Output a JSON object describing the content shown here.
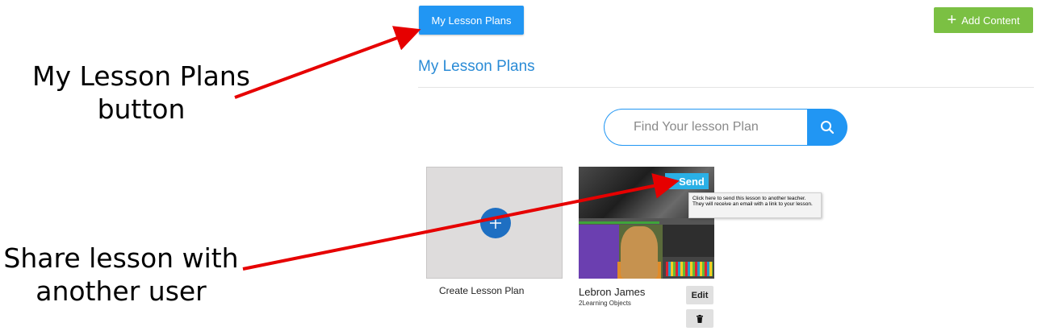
{
  "annotations": {
    "first_line1": "My Lesson Plans",
    "first_line2": "button",
    "second_line1": "Share lesson with",
    "second_line2": "another user",
    "arrow_color": "#e60000"
  },
  "header": {
    "my_lesson_plans_button": "My Lesson Plans",
    "add_content_button": "Add Content",
    "primary_color": "#2196f3",
    "add_color": "#7bc043"
  },
  "page": {
    "title": "My Lesson Plans"
  },
  "search": {
    "placeholder": "Find Your lesson Plan",
    "icon": "search-icon"
  },
  "create_card": {
    "label": "Create Lesson Plan",
    "icon": "plus-icon"
  },
  "lesson_card": {
    "send_label": "Send",
    "tooltip": "Click here to send this lesson to another teacher.  They will receive an email with a link to your lesson.",
    "title": "Lebron James",
    "meta": "2Learning Objects",
    "edit_label": "Edit",
    "delete_icon": "trash-icon"
  }
}
